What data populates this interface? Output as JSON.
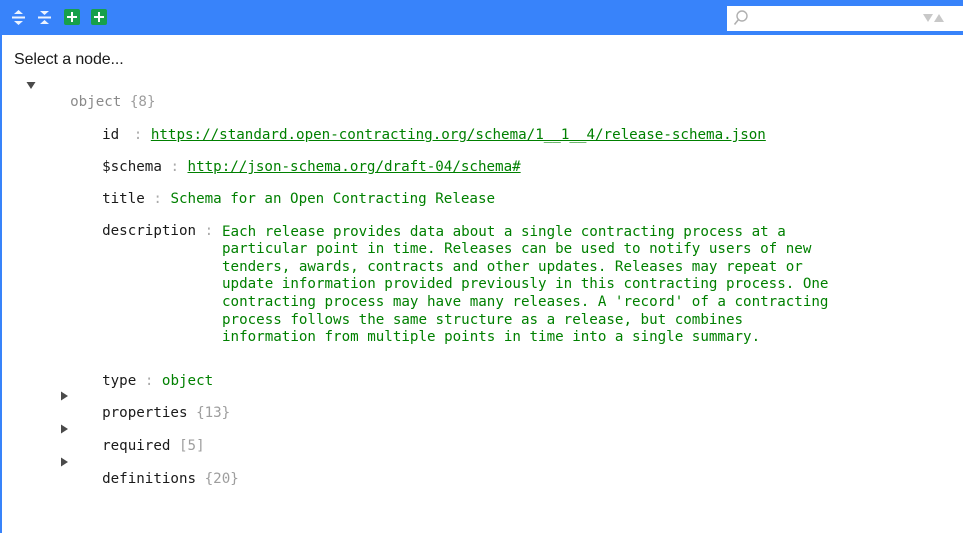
{
  "toolbar": {
    "expand_all_title": "Expand all fields",
    "collapse_all_title": "Collapse all fields",
    "accent": "#3883fa",
    "add_color": "#17a04a"
  },
  "search": {
    "value": "",
    "placeholder": ""
  },
  "navigation": {
    "text": "Select a node..."
  },
  "tree": {
    "root": {
      "type_label": "object",
      "count": "{8}"
    },
    "fields": {
      "id": {
        "key": "id",
        "value": "https://standard.open-contracting.org/schema/1__1__4/release-schema.json"
      },
      "schema": {
        "key": "$schema",
        "value": "http://json-schema.org/draft-04/schema#"
      },
      "title": {
        "key": "title",
        "value": "Schema for an Open Contracting Release"
      },
      "description": {
        "key": "description",
        "lines": [
          "Each release provides data about a single contracting process at a",
          "particular point in time. Releases can be used to notify users of new",
          "tenders, awards, contracts and other updates. Releases may repeat or",
          "update information provided previously in this contracting process. One",
          "contracting process may have many releases. A 'record' of a contracting",
          "process follows the same structure as a release, but combines",
          "information from multiple points in time into a single summary."
        ]
      },
      "type": {
        "key": "type",
        "value": "object"
      },
      "properties": {
        "key": "properties",
        "count": "{13}"
      },
      "required": {
        "key": "required",
        "count": "[5]"
      },
      "definitions": {
        "key": "definitions",
        "count": "{20}"
      }
    },
    "separator": ":",
    "value_color": "#008000"
  }
}
